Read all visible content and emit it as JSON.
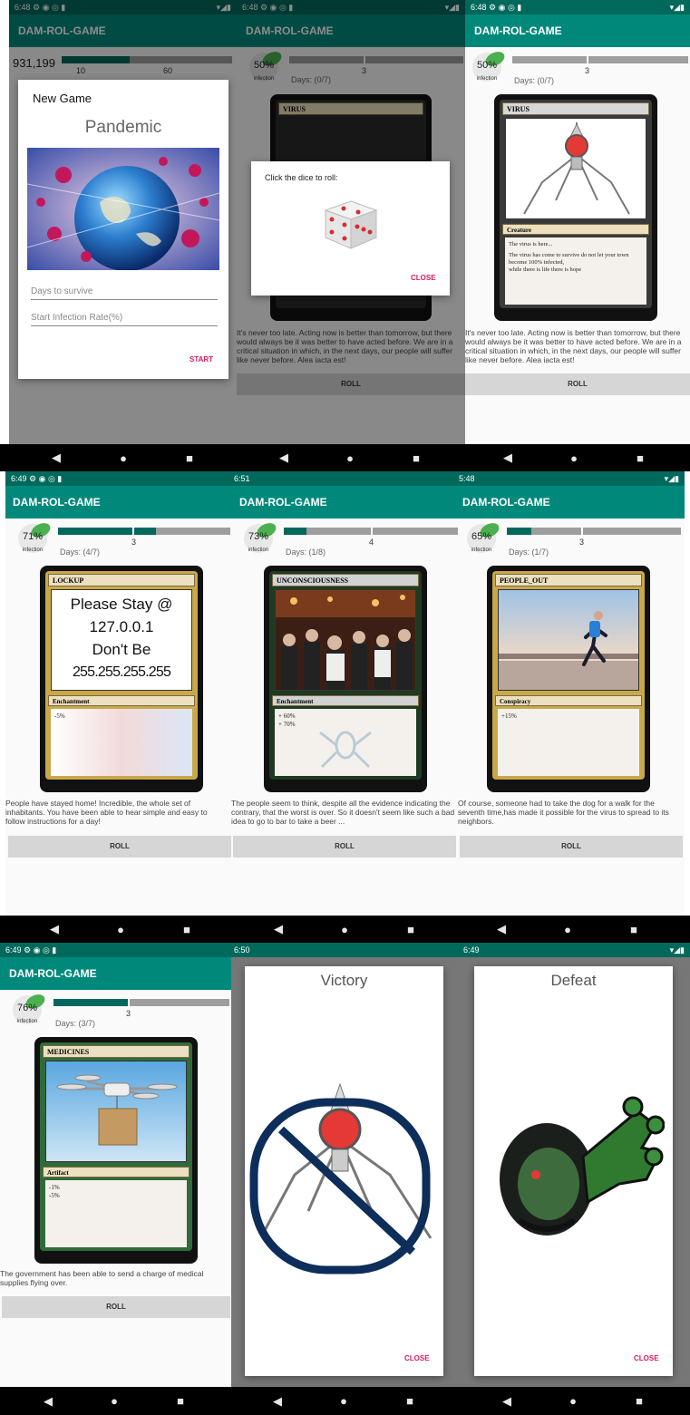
{
  "app": {
    "title": "DAM-ROL-GAME",
    "accent": "#00897b",
    "status_color": "#00695c",
    "dialog_button_color": "#d81b60"
  },
  "status": {
    "row1": [
      "6:48",
      "6:48",
      "6:48"
    ],
    "row2": [
      "6:49",
      "6:51",
      "5:48"
    ],
    "row3": [
      "6:49",
      "6:50",
      "6:49"
    ]
  },
  "nav_icons": {
    "back": "◀",
    "home": "●",
    "recents": "■"
  },
  "new_game_dialog": {
    "heading": "New Game",
    "title": "Pandemic",
    "days_placeholder": "Days to survive",
    "rate_placeholder": "Start Infection Rate(%)",
    "start_label": "START",
    "behind_number": "931,199",
    "behind_ticks": [
      "10",
      "60"
    ]
  },
  "dice_dialog": {
    "prompt": "Click the dice to roll:",
    "close_label": "CLOSE",
    "percent": "50%",
    "days": "Days: (0/7)",
    "tick": "3"
  },
  "screens": [
    {
      "percent": "50%",
      "infection": "infection",
      "days": "Days: (0/7)",
      "tick": "3",
      "progress": 0.0,
      "card_title": "VIRUS",
      "card_type": "Creature",
      "card_text": [
        "The virus is here...",
        "The virus has come to survive do not let your town become 100% infected,",
        "while there is life there is hope"
      ],
      "story": "It's never too late. Acting now is better than tomorrow, but there would always be it was better to have acted before. We are in a critical situation in which, in the next days, our people will suffer like never before. Alea iacta est!",
      "roll": "ROLL"
    },
    {
      "percent": "71%",
      "infection": "infection",
      "days": "Days: (4/7)",
      "tick": "3",
      "progress": 0.57,
      "card_title": "LOCKUP",
      "card_type": "Enchantment",
      "card_art_lines": [
        "Please Stay @",
        "127.0.0.1",
        "Don't Be",
        "255.255.255.255"
      ],
      "card_text": [
        "-5%"
      ],
      "story": "People have stayed home! Incredible, the whole set of inhabitants. You have been able to hear simple and easy to follow instructions for a day!",
      "roll": "ROLL"
    },
    {
      "percent": "73%",
      "infection": "infection",
      "days": "Days: (1/8)",
      "tick": "4",
      "progress": 0.125,
      "card_title": "UNCONSCIOUSNESS",
      "card_type": "Enchantment",
      "card_text": [
        "+ 60%",
        "+ 70%"
      ],
      "story": "The people seem to think, despite all the evidence indicating the contrary, that the worst is over. So it doesn't seem like such a bad idea to go to bar to take a beer ...",
      "roll": "ROLL"
    },
    {
      "percent": "65%",
      "infection": "infection",
      "days": "Days: (1/7)",
      "tick": "3",
      "progress": 0.14,
      "card_title": "PEOPLE_OUT",
      "card_type": "Conspiracy",
      "card_text": [
        "+15%"
      ],
      "story": "Of course, someone had to take the dog for a walk for the seventh time,has made it possible for the virus to spread to its neighbors.",
      "roll": "ROLL"
    },
    {
      "percent": "76%",
      "infection": "infection",
      "days": "Days: (3/7)",
      "tick": "3",
      "progress": 0.43,
      "card_title": "MEDICINES",
      "card_type": "Artifact",
      "card_text": [
        "-1%",
        "-5%"
      ],
      "story": "The government has been able to send a charge of medical supplies flying over.",
      "roll": "ROLL"
    }
  ],
  "victory": {
    "title": "Victory",
    "close_label": "CLOSE"
  },
  "defeat": {
    "title": "Defeat",
    "close_label": "CLOSE"
  }
}
